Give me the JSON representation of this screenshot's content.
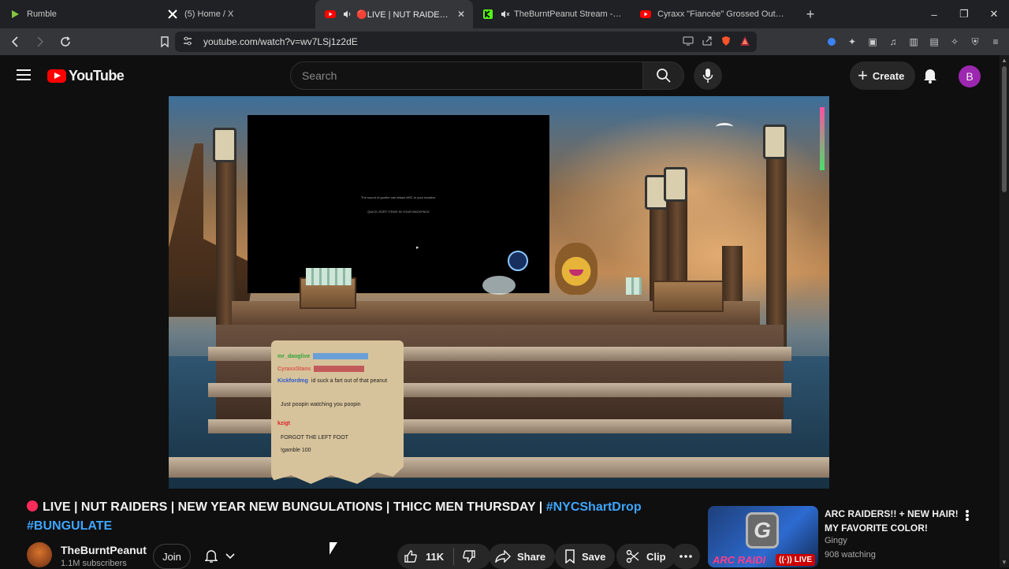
{
  "browser": {
    "tabs": [
      {
        "title": "Rumble",
        "icon": "rumble-favicon",
        "active": false
      },
      {
        "title": "(5) Home / X",
        "icon": "x-favicon",
        "active": false
      },
      {
        "title": "🔴LIVE | NUT RAIDERS | NEW",
        "icon": "youtube-favicon",
        "active": true
      },
      {
        "title": "TheBurntPeanut Stream - Watch",
        "icon": "kick-favicon",
        "active": false
      },
      {
        "title": "Cyraxx \"Fiancée\" Grossed Out by His",
        "icon": "youtube-favicon",
        "active": false
      }
    ],
    "url": "youtube.com/watch?v=wv7LSj1z2dE"
  },
  "youtube": {
    "logo_text": "YouTube",
    "search_placeholder": "Search",
    "create_label": "Create",
    "account_initial": "B"
  },
  "stream_overlay": {
    "chat": [
      {
        "user": "mr_daoglive",
        "text": ""
      },
      {
        "user": "CyraxxStans",
        "text": ""
      },
      {
        "user": "Kickfordmg",
        "text": "id suck a fart out of that peanut"
      },
      {
        "user": "",
        "text": "Just poopin watching you poopin"
      },
      {
        "user": "kzigt",
        "text": ""
      },
      {
        "user": "",
        "text": "FORGOT THE LEFT FOOT"
      },
      {
        "user": "",
        "text": "!gamble 100"
      }
    ]
  },
  "video": {
    "title_prefix": "LIVE | NUT RAIDERS | NEW YEAR NEW BUNGULATIONS | THICC MEN THURSDAY | ",
    "hashtag1": "#NYCShartDrop",
    "hashtag2": "#BUNGULATE",
    "channel_name": "TheBurntPeanut",
    "subscribers": "1.1M subscribers",
    "join_label": "Join",
    "likes": "11K",
    "share_label": "Share",
    "save_label": "Save",
    "clip_label": "Clip"
  },
  "related": {
    "title": "ARC RAIDERS!! + NEW HAIR! MY FAVORITE COLOR!",
    "channel": "Gingy",
    "watching": "908 watching",
    "thumb_text": "ARC RAIDI",
    "live_badge": "LIVE"
  },
  "colors": {
    "youtube_red": "#ff0000",
    "link_blue": "#3ea6ff",
    "avatar_purple": "#9c27b0",
    "live_red": "#cc0000"
  }
}
